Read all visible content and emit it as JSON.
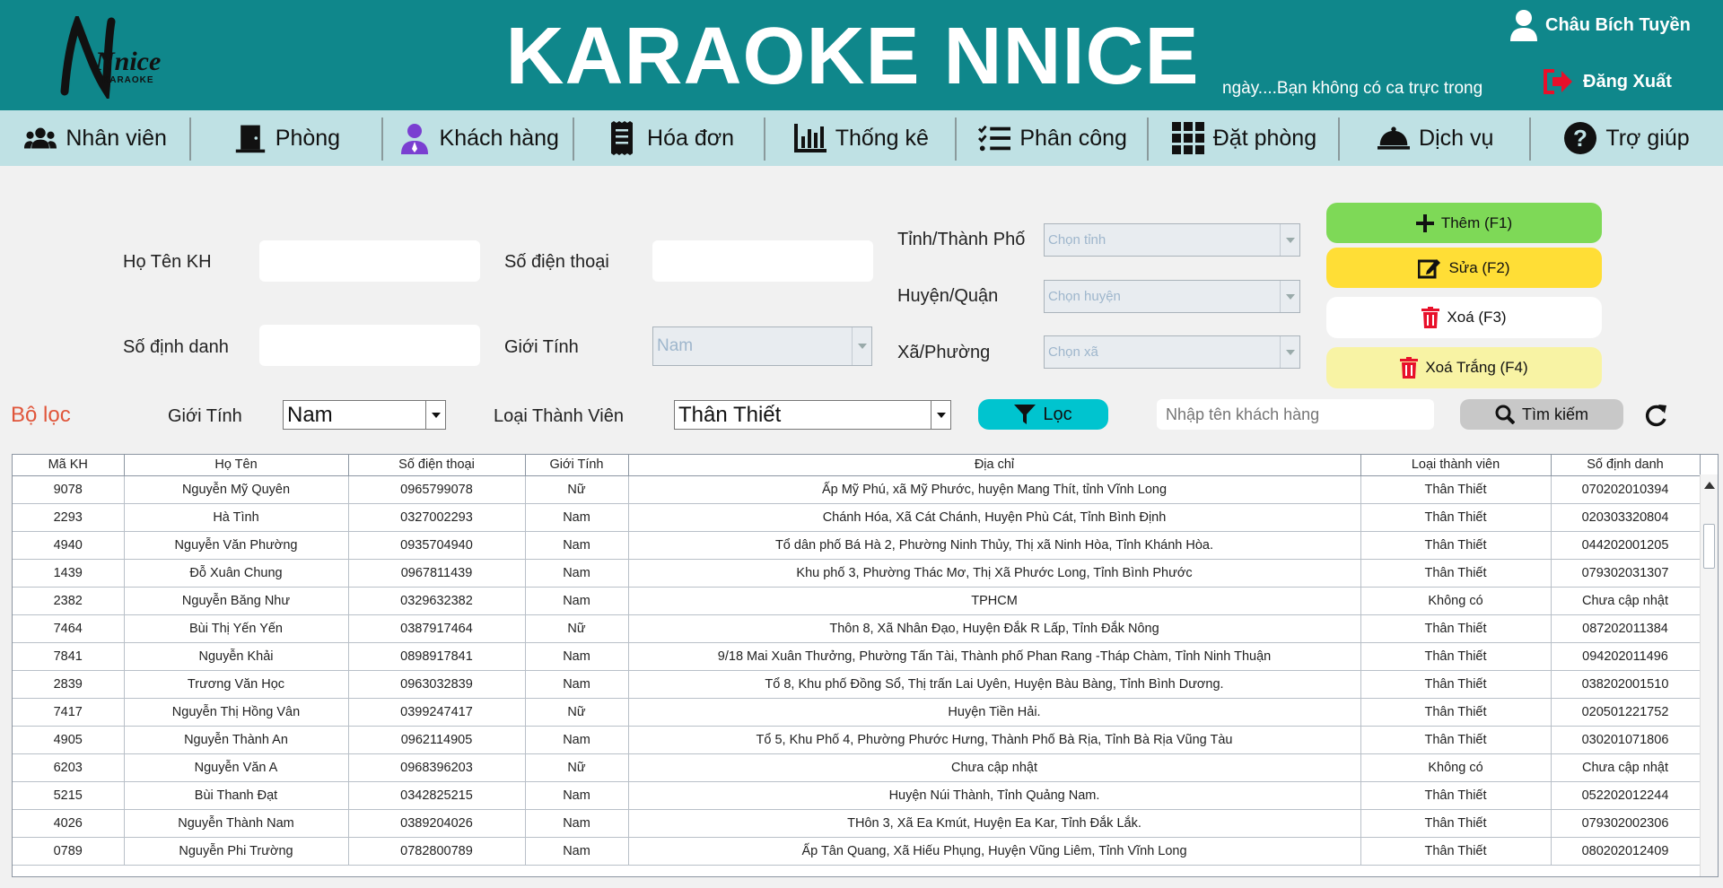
{
  "header": {
    "logo_word": "Nnice",
    "logo_sub": "KARAOKE",
    "title": "KARAOKE NNICE",
    "shift_note": "ngày....Bạn không có ca trực trong",
    "user_name": "Châu Bích Tuyền",
    "logout_label": "Đăng Xuất"
  },
  "nav": [
    {
      "label": "Nhân viên",
      "icon": "users-icon"
    },
    {
      "label": "Phòng",
      "icon": "door-icon"
    },
    {
      "label": "Khách hàng",
      "icon": "customer-icon"
    },
    {
      "label": "Hóa đơn",
      "icon": "receipt-icon"
    },
    {
      "label": "Thống kê",
      "icon": "bar-chart-icon"
    },
    {
      "label": "Phân công",
      "icon": "checklist-icon"
    },
    {
      "label": "Đặt phòng",
      "icon": "grid-icon"
    },
    {
      "label": "Dịch vụ",
      "icon": "service-bell-icon"
    },
    {
      "label": "Trợ giúp",
      "icon": "help-icon"
    }
  ],
  "form": {
    "name_label": "Họ Tên KH",
    "phone_label": "Số điện thoại",
    "id_label": "Số định danh",
    "gender_label": "Giới Tính",
    "gender_value": "Nam",
    "province_label": "Tỉnh/Thành Phố",
    "province_placeholder": "Chọn tỉnh",
    "district_label": "Huyện/Quận",
    "district_placeholder": "Chọn huyện",
    "ward_label": "Xã/Phường",
    "ward_placeholder": "Chọn xã"
  },
  "actions": {
    "add": "Thêm (F1)",
    "edit": "Sửa (F2)",
    "delete": "Xoá (F3)",
    "clear": "Xoá Trắng (F4)"
  },
  "filter": {
    "title": "Bộ lọc",
    "gender_label": "Giới Tính",
    "gender_value": "Nam",
    "member_label": "Loại Thành Viên",
    "member_value": "Thân Thiết",
    "filter_button": "Lọc",
    "search_placeholder": "Nhập tên khách hàng",
    "search_button": "Tìm kiếm"
  },
  "table": {
    "headers": [
      "Mã KH",
      "Họ Tên",
      "Số điện thoại",
      "Giới Tính",
      "Địa chỉ",
      "Loại thành viên",
      "Số định danh"
    ],
    "rows": [
      [
        "9078",
        "Nguyễn Mỹ Quyên",
        "0965799078",
        "Nữ",
        "Ấp Mỹ Phú, xã Mỹ Phước, huyện Mang Thít, tỉnh Vĩnh Long",
        "Thân Thiết",
        "070202010394"
      ],
      [
        "2293",
        "Hà Tình",
        "0327002293",
        "Nam",
        "Chánh Hóa, Xã Cát Chánh, Huyện Phù Cát, Tỉnh Bình Định",
        "Thân Thiết",
        "020303320804"
      ],
      [
        "4940",
        "Nguyễn Văn Phường",
        "0935704940",
        "Nam",
        "Tổ dân phố Bá Hà 2, Phường Ninh Thủy, Thị xã Ninh Hòa, Tỉnh Khánh Hòa.",
        "Thân Thiết",
        "044202001205"
      ],
      [
        "1439",
        "Đỗ Xuân Chung",
        "0967811439",
        "Nam",
        "Khu phố 3, Phường Thác Mơ, Thị Xã Phước Long, Tỉnh Bình Phước",
        "Thân Thiết",
        "079302031307"
      ],
      [
        "2382",
        "Nguyễn Băng Như",
        "0329632382",
        "Nam",
        "TPHCM",
        "Không có",
        "Chưa cập nhật"
      ],
      [
        "7464",
        "Bùi Thị Yến Yến",
        "0387917464",
        "Nữ",
        "Thôn 8, Xã Nhân Đạo, Huyện Đắk R Lấp, Tỉnh Đắk Nông",
        "Thân Thiết",
        "087202011384"
      ],
      [
        "7841",
        "Nguyễn Khải",
        "0898917841",
        "Nam",
        "9/18 Mai Xuân Thưởng, Phường Tấn Tài, Thành phố Phan Rang -Tháp Chàm, Tỉnh Ninh Thuận",
        "Thân Thiết",
        "094202011496"
      ],
      [
        "2839",
        "Trương Văn Học",
        "0963032839",
        "Nam",
        "Tổ 8, Khu phố Đồng Sổ, Thị trấn Lai Uyên, Huyện Bàu Bàng, Tỉnh Bình Dương.",
        "Thân Thiết",
        "038202001510"
      ],
      [
        "7417",
        "Nguyễn Thị Hồng Vân",
        "0399247417",
        "Nữ",
        "Huyện Tiền Hải.",
        "Thân Thiết",
        "020501221752"
      ],
      [
        "4905",
        "Nguyễn Thành An",
        "0962114905",
        "Nam",
        "Tổ 5, Khu Phố 4, Phường Phước Hưng, Thành Phố Bà Rịa, Tỉnh Bà Rịa Vũng Tàu",
        "Thân Thiết",
        "030201071806"
      ],
      [
        "6203",
        "Nguyễn Văn A",
        "0968396203",
        "Nữ",
        "Chưa cập nhật",
        "Không có",
        "Chưa cập nhật"
      ],
      [
        "5215",
        "Bùi Thanh Đạt",
        "0342825215",
        "Nam",
        "Huyện Núi Thành, Tỉnh Quảng Nam.",
        "Thân Thiết",
        "052202012244"
      ],
      [
        "4026",
        "Nguyễn Thành Nam",
        "0389204026",
        "Nam",
        "THôn 3, Xã Ea Kmút, Huyện Ea Kar, Tỉnh Đắk Lắk.",
        "Thân Thiết",
        "079302002306"
      ],
      [
        "0789",
        "Nguyễn Phi Trường",
        "0782800789",
        "Nam",
        "Ấp Tân Quang, Xã Hiếu Phụng, Huyện Vũng Liêm, Tỉnh Vĩnh Long",
        "Thân Thiết",
        "080202012409"
      ]
    ]
  },
  "colors": {
    "header_bg": "#0f878b",
    "nav_bg": "#bfe1e4",
    "add_btn": "#7ed957",
    "edit_btn": "#ffde36",
    "delete_btn": "#ffffff",
    "clear_btn": "#f8f3a4",
    "filter_btn": "#00c4cf",
    "search_btn": "#c8c8c8",
    "filter_title": "#e0553a"
  }
}
